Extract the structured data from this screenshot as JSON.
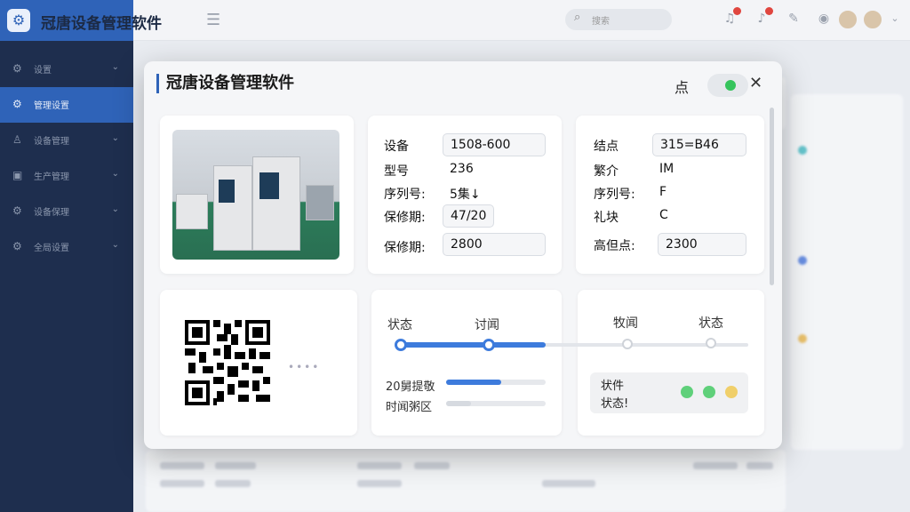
{
  "app": {
    "title": "冠唐设备管理软件",
    "logo_icon": "gear-logo-icon"
  },
  "topbar": {
    "search_placeholder": "搜索"
  },
  "sidebar": {
    "items": [
      {
        "label": "设置",
        "icon": "gear-icon"
      },
      {
        "label": "管理设置",
        "icon": "settings-icon",
        "active": true
      },
      {
        "label": "设备管理",
        "icon": "user-icon"
      },
      {
        "label": "生产管理",
        "icon": "clipboard-icon"
      },
      {
        "label": "设备保理",
        "icon": "gear-icon"
      },
      {
        "label": "全局设置",
        "icon": "gear-icon"
      }
    ]
  },
  "modal": {
    "title": "冠唐设备管理软件",
    "dot_label": "点",
    "toggle_on": true,
    "close_icon": "close-icon",
    "details_left": [
      {
        "label": "设备",
        "value": "1508-600",
        "boxed": true
      },
      {
        "label": "型号",
        "value": "236",
        "boxed": false
      },
      {
        "label": "序列号:",
        "value": "5集↓",
        "boxed": false
      },
      {
        "label": "保修期:",
        "value": "47/20",
        "boxed": true
      },
      {
        "label": "保修期:",
        "value": "2800",
        "boxed": true
      }
    ],
    "details_right": [
      {
        "label": "结点",
        "value": "315=B46",
        "boxed": true
      },
      {
        "label": "繁介",
        "value": "IM",
        "boxed": false
      },
      {
        "label": "序列号:",
        "value": "F",
        "boxed": false
      },
      {
        "label": "礼块",
        "value": "C",
        "boxed": false
      },
      {
        "label": "高但点:",
        "value": "2300",
        "boxed": true
      }
    ],
    "timeline": {
      "labels": [
        "状态",
        "讨闻",
        "牧闻",
        "状态"
      ],
      "active_steps": 2
    },
    "progress": [
      {
        "label": "20舅提敬",
        "fraction": 0.55
      },
      {
        "label": "时闻粥区",
        "fraction": 0.25
      }
    ],
    "status": {
      "line1": "状件",
      "line2": "状态!",
      "dots": [
        "#5fd07a",
        "#5fd07a",
        "#f0cf6a"
      ]
    }
  }
}
